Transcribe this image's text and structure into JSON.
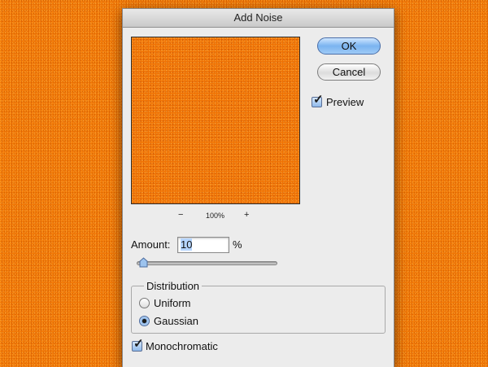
{
  "dialog": {
    "title": "Add Noise",
    "ok_label": "OK",
    "cancel_label": "Cancel",
    "preview": {
      "label": "Preview",
      "checked": true
    },
    "zoom": {
      "minus": "−",
      "level": "100%",
      "plus": "+"
    },
    "amount": {
      "label": "Amount:",
      "value": "10",
      "unit": "%",
      "slider_percent": 10
    },
    "distribution": {
      "label": "Distribution",
      "options": [
        {
          "label": "Uniform",
          "selected": false
        },
        {
          "label": "Gaussian",
          "selected": true
        }
      ]
    },
    "monochromatic": {
      "label": "Monochromatic",
      "checked": true
    }
  },
  "colors": {
    "background_orange": "#f47a06",
    "dialog_gray": "#ececec",
    "accent_blue": "#7ab4f0"
  }
}
